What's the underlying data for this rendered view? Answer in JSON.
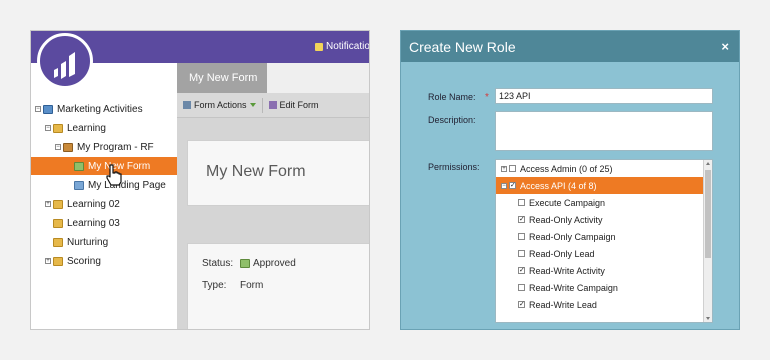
{
  "left_panel": {
    "notifications_label": "Notificatio",
    "tree": [
      {
        "label": "Marketing Activities",
        "icon": "activities-icon"
      },
      {
        "label": "Learning",
        "icon": "folder-icon"
      },
      {
        "label": "My Program - RF",
        "icon": "program-icon"
      },
      {
        "label": "My New Form",
        "icon": "form-icon",
        "selected": true
      },
      {
        "label": "My Landing Page",
        "icon": "landing-page-icon"
      },
      {
        "label": "Learning 02",
        "icon": "folder-icon"
      },
      {
        "label": "Learning 03",
        "icon": "folder-icon"
      },
      {
        "label": "Nurturing",
        "icon": "folder-icon"
      },
      {
        "label": "Scoring",
        "icon": "folder-icon"
      }
    ],
    "tab_label": "My New Form",
    "toolbar": {
      "form_actions": "Form Actions",
      "edit_form": "Edit Form"
    },
    "form_title": "My New Form",
    "status_label": "Status:",
    "status_value": "Approved",
    "type_label": "Type:",
    "type_value": "Form"
  },
  "dialog": {
    "title": "Create New Role",
    "close": "×",
    "role_name_label": "Role Name:",
    "role_name_value": "123 API",
    "required_marker": "*",
    "description_label": "Description:",
    "description_value": "",
    "permissions_label": "Permissions:",
    "permissions": [
      {
        "label": "Access Admin (0 of 25)",
        "checked": false,
        "expander": "+"
      },
      {
        "label": "Access API (4 of 8)",
        "checked": true,
        "expander": "−",
        "selected": true
      },
      {
        "label": "Execute Campaign",
        "checked": false
      },
      {
        "label": "Read-Only Activity",
        "checked": true
      },
      {
        "label": "Read-Only Campaign",
        "checked": false
      },
      {
        "label": "Read-Only Lead",
        "checked": false
      },
      {
        "label": "Read-Write Activity",
        "checked": true
      },
      {
        "label": "Read-Write Campaign",
        "checked": false
      },
      {
        "label": "Read-Write Lead",
        "checked": true
      }
    ]
  },
  "colors": {
    "accent_orange": "#ee7a23",
    "header_purple": "#5b4a9f",
    "dialog_teal": "#4f8798",
    "dialog_bg": "#8cc2d3"
  }
}
